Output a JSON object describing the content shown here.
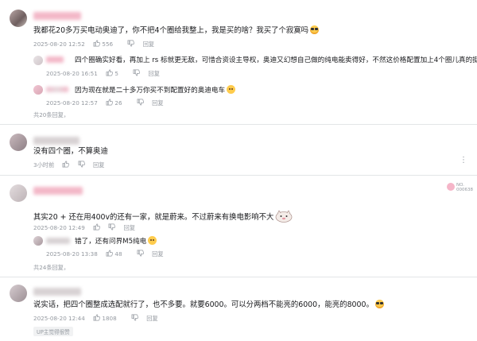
{
  "colors": {
    "text": "#18191c",
    "meta": "#9499a0",
    "divider": "#e3e5e7",
    "accent_pink": "#f3b8c8"
  },
  "icons": {
    "like": "thumbs-up-icon",
    "dislike": "thumbs-down-icon",
    "more": "more-dots-icon"
  },
  "comments": [
    {
      "text": "我都花20多万买电动奥迪了，你不把4个圈给我整上，我是买的啥？我买了个寂寞吗",
      "time": "2025-08-20 12:52",
      "likes": "556",
      "reply": "回复",
      "replies": [
        {
          "text": "四个圈确实好看，再加上 rs 标就更无敌，可惜合资设主导权，奥迪又幻想自己做的纯电能卖得好，不然这价格配置加上4个圈儿真的挺无敌的",
          "time": "2025-08-20 16:51",
          "likes": "5",
          "reply": "回复"
        },
        {
          "text": "因为现在就是二十多万你买不到配置好的奥迪电车",
          "time": "2025-08-20 12:57",
          "likes": "26",
          "reply": "回复"
        }
      ],
      "more": "共20条回复，"
    },
    {
      "text": "没有四个圈，不算奥迪",
      "time": "3小时前",
      "likes": "",
      "reply": "回复"
    },
    {
      "text": "其实20 + 还在用400v的还有一家，就是蔚来。不过蔚来有换电影响不大",
      "time": "2025-08-20 12:49",
      "likes": "",
      "reply": "回复",
      "badge_line1": "NO.",
      "badge_line2": "000638",
      "replies": [
        {
          "text": "错了，还有问界M5纯电",
          "time": "2025-08-20 13:38",
          "likes": "48",
          "reply": "回复"
        }
      ],
      "more": "共24条回复，"
    },
    {
      "text": "说实话，把四个圈整成选配就行了，也不多要。就要6000。可以分两档不能亮的6000，能亮的8000。",
      "time": "2025-08-20 12:44",
      "likes": "1808",
      "reply": "回复",
      "up_badge": "UP主觉得很赞"
    }
  ]
}
